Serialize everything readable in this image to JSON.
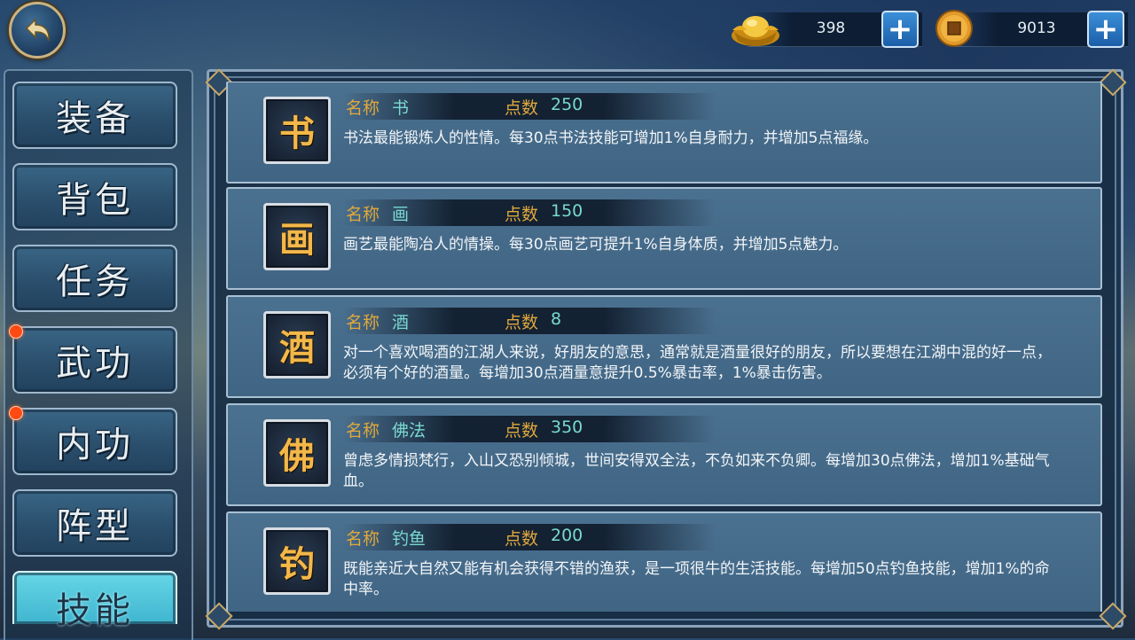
{
  "header": {
    "back_icon": "back-arrow-icon",
    "gold": {
      "icon": "gold-ingot-icon",
      "value": "398",
      "add_icon": "plus-icon"
    },
    "coin": {
      "icon": "copper-coin-icon",
      "value": "9013",
      "add_icon": "plus-icon"
    }
  },
  "tabs": [
    {
      "label": "装备",
      "badge": false,
      "active": false
    },
    {
      "label": "背包",
      "badge": false,
      "active": false
    },
    {
      "label": "任务",
      "badge": false,
      "active": false
    },
    {
      "label": "武功",
      "badge": true,
      "active": false
    },
    {
      "label": "内功",
      "badge": true,
      "active": false
    },
    {
      "label": "阵型",
      "badge": false,
      "active": false
    },
    {
      "label": "技能",
      "badge": false,
      "active": true
    }
  ],
  "skills": [
    {
      "icon_char": "书",
      "name_label": "名称",
      "name": "书",
      "points_label": "点数",
      "points": "250",
      "desc": "书法最能锻炼人的性情。每30点书法技能可增加1%自身耐力，并增加5点福缘。"
    },
    {
      "icon_char": "画",
      "name_label": "名称",
      "name": "画",
      "points_label": "点数",
      "points": "150",
      "desc": "画艺最能陶冶人的情操。每30点画艺可提升1%自身体质，并增加5点魅力。"
    },
    {
      "icon_char": "酒",
      "name_label": "名称",
      "name": "酒",
      "points_label": "点数",
      "points": "8",
      "desc": "对一个喜欢喝酒的江湖人来说，好朋友的意思，通常就是酒量很好的朋友，所以要想在江湖中混的好一点，必须有个好的酒量。每增加30点酒量意提升0.5%暴击率，1%暴击伤害。"
    },
    {
      "icon_char": "佛",
      "name_label": "名称",
      "name": "佛法",
      "points_label": "点数",
      "points": "350",
      "desc": "曾虑多情损梵行，入山又恐别倾城，世间安得双全法，不负如来不负卿。每增加30点佛法，增加1%基础气血。"
    },
    {
      "icon_char": "钓",
      "name_label": "名称",
      "name": "钓鱼",
      "points_label": "点数",
      "points": "200",
      "desc": "既能亲近大自然又能有机会获得不错的渔获，是一项很牛的生活技能。每增加50点钓鱼技能，增加1%的命中率。"
    }
  ]
}
